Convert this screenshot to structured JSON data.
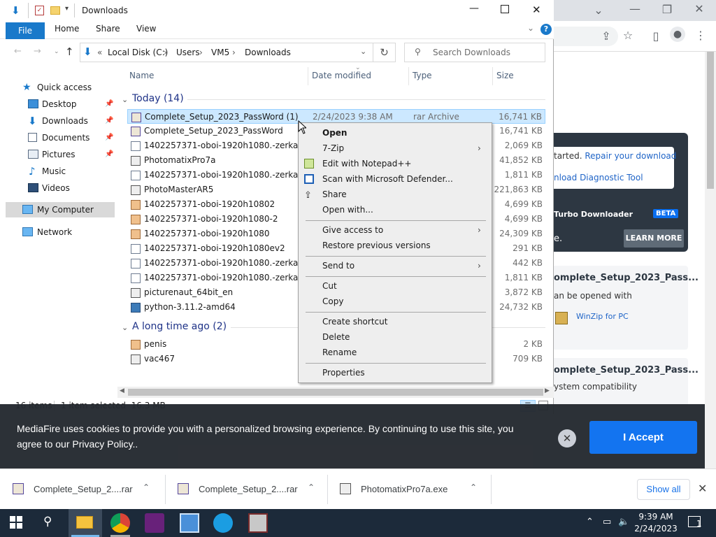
{
  "explorer": {
    "title": "Downloads",
    "ribbon": {
      "file": "File",
      "home": "Home",
      "share": "Share",
      "view": "View"
    },
    "address": [
      "Local Disk (C:)",
      "Users",
      "VM5",
      "Downloads"
    ],
    "address_prefix": "«",
    "search_placeholder": "Search Downloads",
    "columns": {
      "name": "Name",
      "date": "Date modified",
      "type": "Type",
      "size": "Size"
    },
    "nav": [
      {
        "label": "Quick access"
      },
      {
        "label": "Desktop"
      },
      {
        "label": "Downloads"
      },
      {
        "label": "Documents"
      },
      {
        "label": "Pictures"
      },
      {
        "label": "Music"
      },
      {
        "label": "Videos"
      },
      {
        "label": "My Computer"
      },
      {
        "label": "Network"
      }
    ],
    "groups": {
      "today": "Today (14)",
      "old": "A long time ago (2)"
    },
    "files": [
      {
        "name": "Complete_Setup_2023_PassWord (1)",
        "date": "2/24/2023 9:38 AM",
        "type": "rar Archive",
        "size": "16,741 KB",
        "icon": "rar"
      },
      {
        "name": "Complete_Setup_2023_PassWord",
        "date": "",
        "type": "",
        "size": "16,741 KB",
        "icon": "rar"
      },
      {
        "name": "1402257371-oboi-1920h1080.-zerkala-me...",
        "date": "",
        "type": "",
        "size": "2,069 KB",
        "icon": "doc"
      },
      {
        "name": "PhotomatixPro7a",
        "date": "",
        "type": "",
        "size": "41,852 KB",
        "icon": "exe"
      },
      {
        "name": "1402257371-oboi-1920h1080.-zerkala-me...",
        "date": "",
        "type": "",
        "size": "1,811 KB",
        "icon": "doc"
      },
      {
        "name": "PhotoMasterAR5",
        "date": "",
        "type": "",
        "size": "221,863 KB",
        "icon": "exe"
      },
      {
        "name": "1402257371-oboi-1920h10802",
        "date": "",
        "type": "",
        "size": "4,699 KB",
        "icon": "img"
      },
      {
        "name": "1402257371-oboi-1920h1080-2",
        "date": "",
        "type": "",
        "size": "4,699 KB",
        "icon": "img"
      },
      {
        "name": "1402257371-oboi-1920h1080",
        "date": "",
        "type": "",
        "size": "24,309 KB",
        "icon": "img"
      },
      {
        "name": "1402257371-oboi-1920h1080ev2",
        "date": "",
        "type": "",
        "size": "291 KB",
        "icon": "doc"
      },
      {
        "name": "1402257371-oboi-1920h1080.-zerkala-me...",
        "date": "",
        "type": "",
        "size": "442 KB",
        "icon": "doc"
      },
      {
        "name": "1402257371-oboi-1920h1080.-zerkala-me...",
        "date": "",
        "type": "",
        "size": "1,811 KB",
        "icon": "blank"
      },
      {
        "name": "picturenaut_64bit_en",
        "date": "",
        "type": "",
        "size": "3,872 KB",
        "icon": "exe"
      },
      {
        "name": "python-3.11.2-amd64",
        "date": "",
        "type": "",
        "size": "24,732 KB",
        "icon": "py"
      }
    ],
    "old_files": [
      {
        "name": "penis",
        "size": "2 KB",
        "icon": "img"
      },
      {
        "name": "vac467",
        "size": "709 KB",
        "icon": "exe"
      }
    ],
    "status": {
      "items": "16 items",
      "selected": "1 item selected  16.3 MB"
    }
  },
  "context_menu": {
    "open": "Open",
    "seven_zip": "7-Zip",
    "notepad": "Edit with Notepad++",
    "defender": "Scan with Microsoft Defender...",
    "share": "Share",
    "open_with": "Open with...",
    "give_access": "Give access to",
    "restore": "Restore previous versions",
    "send_to": "Send to",
    "cut": "Cut",
    "copy": "Copy",
    "create_shortcut": "Create shortcut",
    "delete": "Delete",
    "rename": "Rename",
    "properties": "Properties"
  },
  "browser": {
    "repair_text": "tarted.",
    "repair_link": "Repair your download",
    "diag_link": "nload Diagnostic Tool",
    "turbo": "Turbo Downloader",
    "beta": "BETA",
    "dark_text": "e.",
    "learn_more": "LEARN MORE",
    "card1_title": "omplete_Setup_2023_Pass...",
    "card1_sub": "an be opened with",
    "winzip": "WinZip for PC",
    "card2_title": "omplete_Setup_2023_Pass...",
    "card2_sub": "ystem compatibility"
  },
  "cookie": {
    "text": "MediaFire uses cookies to provide you with a personalized browsing experience. By continuing to use this site, you agree to our Privacy Policy..",
    "close": "✕",
    "accept": "I Accept"
  },
  "downloads": [
    {
      "name": "Complete_Setup_2....rar"
    },
    {
      "name": "Complete_Setup_2....rar"
    },
    {
      "name": "PhotomatixPro7a.exe"
    }
  ],
  "shelf": {
    "show_all": "Show all"
  },
  "taskbar": {
    "time": "9:39 AM",
    "date": "2/24/2023",
    "notifications": "1"
  },
  "colors": {
    "accent": "#1979ca",
    "selection": "#cce8ff",
    "mediafire_blue": "#0a6ff0"
  }
}
